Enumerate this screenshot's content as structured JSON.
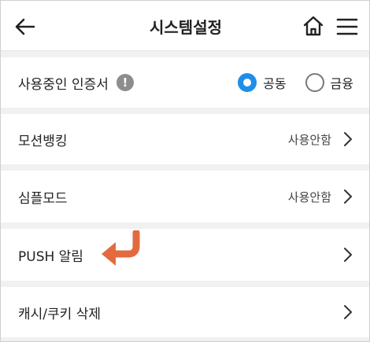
{
  "header": {
    "title": "시스템설정",
    "back_icon": "back-arrow-icon",
    "home_icon": "home-icon",
    "menu_icon": "hamburger-menu-icon"
  },
  "certificate": {
    "label": "사용중인 인증서",
    "info_symbol": "!",
    "options": [
      {
        "label": "공동",
        "selected": true
      },
      {
        "label": "금융",
        "selected": false
      }
    ]
  },
  "settings": [
    {
      "label": "모션뱅킹",
      "value": "사용안함"
    },
    {
      "label": "심플모드",
      "value": "사용안함"
    },
    {
      "label": "PUSH 알림",
      "value": ""
    },
    {
      "label": "캐시/쿠키 삭제",
      "value": ""
    }
  ],
  "colors": {
    "accent": "#1f8ee8",
    "annotation_arrow": "#e36a3f",
    "divider": "#f1f1f1"
  }
}
